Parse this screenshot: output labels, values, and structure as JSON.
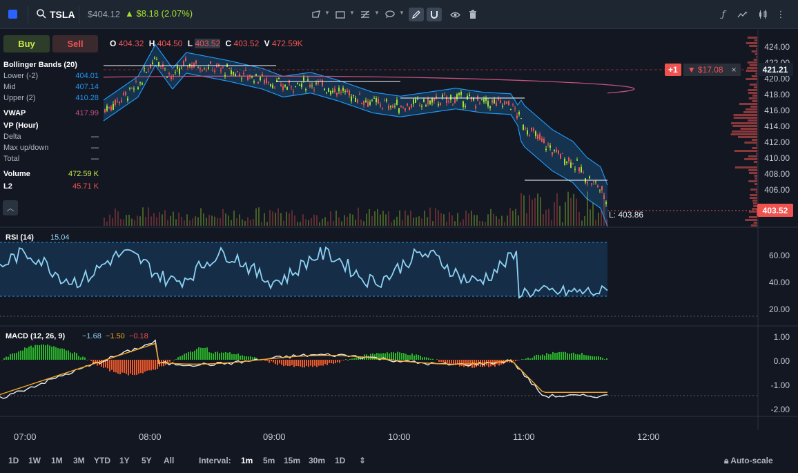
{
  "toolbar": {
    "symbol": "TSLA",
    "price": "$404.12",
    "change": "▲ $8.18 (2.07%)",
    "tools": [
      "trendline-icon",
      "rectangle-icon",
      "fib-icon",
      "lasso-icon",
      "pencil-icon",
      "magnet-icon",
      "eye-icon",
      "trash-icon"
    ],
    "right_tools": [
      "function-icon",
      "indicators-icon",
      "candles-icon",
      "more-icon"
    ]
  },
  "trade": {
    "buy_label": "Buy",
    "sell_label": "Sell"
  },
  "ohlc": {
    "o_label": "O",
    "o": "404.32",
    "h_label": "H",
    "h": "404.50",
    "l_label": "L",
    "l": "403.52",
    "c_label": "C",
    "c": "403.52",
    "v_label": "V",
    "v": "472.59K"
  },
  "legend": {
    "bb_title": "Bollinger Bands (20)",
    "bb_lower_label": "Lower (-2)",
    "bb_lower": "404.01",
    "bb_mid_label": "Mid",
    "bb_mid": "407.14",
    "bb_upper_label": "Upper (2)",
    "bb_upper": "410.28",
    "vwap_label": "VWAP",
    "vwap": "417.99",
    "vp_label": "VP (Hour)",
    "delta_label": "Delta",
    "delta": "—",
    "maxupdown_label": "Max up/down",
    "maxupdown": "—",
    "total_label": "Total",
    "total": "—",
    "volume_label": "Volume",
    "volume": "472.59 K",
    "l2_label": "L2",
    "l2": "45.71 K"
  },
  "price_axis": [
    "424.00",
    "422.00",
    "420.00",
    "418.00",
    "416.00",
    "414.00",
    "412.00",
    "410.00",
    "408.00",
    "406.00"
  ],
  "current_price": "403.52",
  "position_price": "421.21",
  "order": {
    "qty": "+1",
    "pnl": "▼ $17.08",
    "close": "×"
  },
  "low_label": "L: 403.86",
  "rsi": {
    "title": "RSI (14)",
    "value": "15.04",
    "axis": [
      "60.00",
      "40.00",
      "20.00"
    ]
  },
  "macd": {
    "title": "MACD (12, 26, 9)",
    "v1": "−1.68",
    "v2": "−1.50",
    "v3": "−0.18",
    "axis": [
      "1.00",
      "0.00",
      "-1.00",
      "-2.00"
    ]
  },
  "time_axis": [
    "07:00",
    "08:00",
    "09:00",
    "10:00",
    "11:00",
    "12:00"
  ],
  "ranges": [
    "1D",
    "1W",
    "1M",
    "3M",
    "YTD",
    "1Y",
    "5Y",
    "All"
  ],
  "interval_label": "Interval:",
  "intervals": [
    "1m",
    "5m",
    "15m",
    "30m",
    "1D"
  ],
  "selected_interval": "1m",
  "autoscale_label": "Auto-scale",
  "colors": {
    "up": "#a6e22e",
    "down": "#ef5350",
    "bb": "#2196f3",
    "vwap": "#c2527a",
    "rsi": "#8fd3f4",
    "macd": "#ffffff",
    "signal": "#f5a623"
  }
}
